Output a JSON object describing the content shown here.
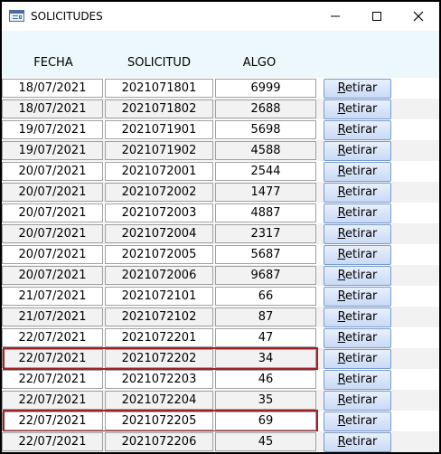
{
  "window": {
    "title": "SOLICITUDES",
    "controls": [
      "minimize",
      "maximize",
      "close"
    ]
  },
  "columns": {
    "fecha": "FECHA",
    "solicitud": "SOLICITUD",
    "algo": "ALGO"
  },
  "button_label": "Retirar",
  "button_accel": "R",
  "button_rest": "etirar",
  "highlight_color": "#a31f24",
  "rows": [
    {
      "fecha": "18/07/2021",
      "solicitud": "2021071801",
      "algo": "6999",
      "highlighted": false
    },
    {
      "fecha": "18/07/2021",
      "solicitud": "2021071802",
      "algo": "2688",
      "highlighted": false
    },
    {
      "fecha": "19/07/2021",
      "solicitud": "2021071901",
      "algo": "5698",
      "highlighted": false
    },
    {
      "fecha": "19/07/2021",
      "solicitud": "2021071902",
      "algo": "4588",
      "highlighted": false
    },
    {
      "fecha": "20/07/2021",
      "solicitud": "2021072001",
      "algo": "2544",
      "highlighted": false
    },
    {
      "fecha": "20/07/2021",
      "solicitud": "2021072002",
      "algo": "1477",
      "highlighted": false
    },
    {
      "fecha": "20/07/2021",
      "solicitud": "2021072003",
      "algo": "4887",
      "highlighted": false
    },
    {
      "fecha": "20/07/2021",
      "solicitud": "2021072004",
      "algo": "2317",
      "highlighted": false
    },
    {
      "fecha": "20/07/2021",
      "solicitud": "2021072005",
      "algo": "5687",
      "highlighted": false
    },
    {
      "fecha": "20/07/2021",
      "solicitud": "2021072006",
      "algo": "9687",
      "highlighted": false
    },
    {
      "fecha": "21/07/2021",
      "solicitud": "2021072101",
      "algo": "66",
      "highlighted": false
    },
    {
      "fecha": "21/07/2021",
      "solicitud": "2021072102",
      "algo": "87",
      "highlighted": false
    },
    {
      "fecha": "22/07/2021",
      "solicitud": "2021072201",
      "algo": "47",
      "highlighted": false
    },
    {
      "fecha": "22/07/2021",
      "solicitud": "2021072202",
      "algo": "34",
      "highlighted": true
    },
    {
      "fecha": "22/07/2021",
      "solicitud": "2021072203",
      "algo": "46",
      "highlighted": false
    },
    {
      "fecha": "22/07/2021",
      "solicitud": "2021072204",
      "algo": "35",
      "highlighted": false
    },
    {
      "fecha": "22/07/2021",
      "solicitud": "2021072205",
      "algo": "69",
      "highlighted": true
    },
    {
      "fecha": "22/07/2021",
      "solicitud": "2021072206",
      "algo": "45",
      "highlighted": false
    }
  ]
}
